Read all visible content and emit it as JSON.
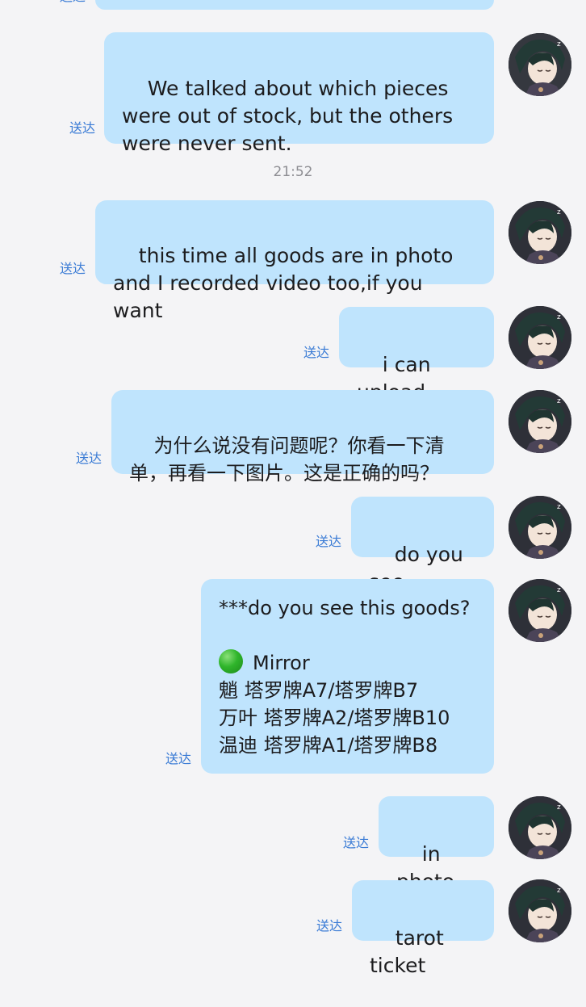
{
  "chat": {
    "status_label": "送达",
    "timestamp": "21:52",
    "messages": [
      {
        "text": "We talked about which pieces were out of stock, but the others were never sent."
      },
      {
        "text": "this time all goods are in photo and I recorded video too,if you want"
      },
      {
        "text": "i can upload"
      },
      {
        "text": "为什么说没有问题呢？你看一下清单，再看一下图片。这是正确的吗？"
      },
      {
        "text": "do you see"
      },
      {
        "line1": "***do you see this goods?",
        "mirror": "Mirror",
        "line3": "魈 塔罗牌A7/塔罗牌B7",
        "line4": "万叶 塔罗牌A2/塔罗牌B10",
        "line5": "温迪 塔罗牌A1/塔罗牌B8",
        "mirror_icon": "green-circle-icon",
        "mirror_icon_color": "#2fb52b"
      },
      {
        "text": "in photo"
      },
      {
        "text": "tarot ticket"
      }
    ],
    "avatar_icon": "character-avatar-icon",
    "colors": {
      "background": "#f4f4f6",
      "bubble": "#bfe4fd",
      "status": "#3a7bd5",
      "timestamp": "#8e8e93"
    }
  }
}
